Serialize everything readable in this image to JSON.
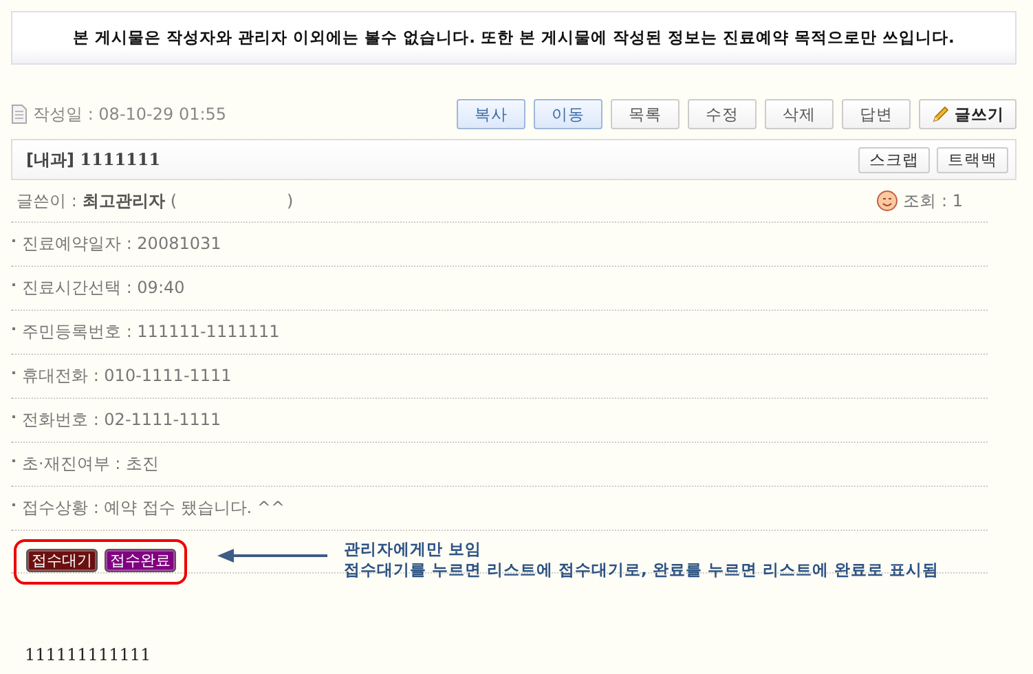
{
  "notice": "본 게시물은 작성자와 관리자 이외에는 볼수 없습니다. 또한 본 게시물에 작성된 정보는 진료예약 목적으로만 쓰입니다.",
  "date": {
    "label": "작성일 :",
    "value": "08-10-29 01:55"
  },
  "actions": [
    {
      "label": "복사",
      "highlighted": true
    },
    {
      "label": "이동",
      "highlighted": true
    },
    {
      "label": "목록",
      "highlighted": false
    },
    {
      "label": "수정",
      "highlighted": false
    },
    {
      "label": "삭제",
      "highlighted": false
    },
    {
      "label": "답변",
      "highlighted": false
    },
    {
      "label": "글쓰기",
      "highlighted": false,
      "kind": "write"
    }
  ],
  "post_title": {
    "category": "[내과]",
    "title": "1111111"
  },
  "title_buttons": [
    "스크랩",
    "트랙백"
  ],
  "author": {
    "label": "글쓴이 :",
    "name": "최고관리자",
    "open": "(",
    "close": ")"
  },
  "views": {
    "label": "조회 :",
    "value": "1"
  },
  "fields": [
    {
      "label": "진료예약일자 :",
      "value": "20081031"
    },
    {
      "label": "진료시간선택 :",
      "value": "09:40"
    },
    {
      "label": "주민등록번호 :",
      "value": "111111-1111111"
    },
    {
      "label": "휴대전화 :",
      "value": "010-1111-1111"
    },
    {
      "label": "전화번호 :",
      "value": "02-1111-1111"
    },
    {
      "label": "초·재진여부 :",
      "value": "초진"
    },
    {
      "label": "접수상황 :",
      "value": "예약 접수 됐습니다. ^^"
    }
  ],
  "status_buttons": [
    {
      "label": "접수대기",
      "color": "#6b1010"
    },
    {
      "label": "접수완료",
      "color": "#800080"
    }
  ],
  "annotation": [
    "관리자에게만 보임",
    "접수대기를 누르면 리스트에 접수대기로, 완료를 누르면 리스트에 완료로 표시됨"
  ],
  "body": "111111111111"
}
